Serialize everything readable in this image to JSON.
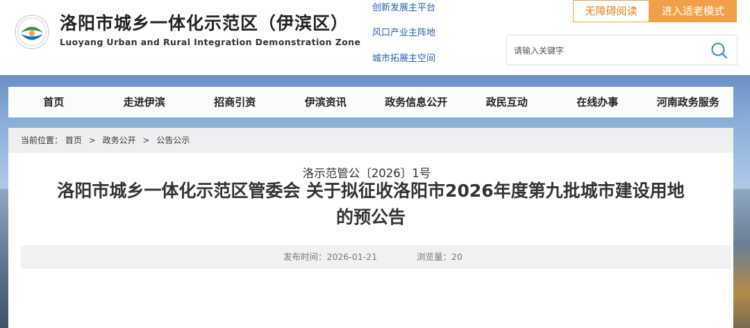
{
  "header": {
    "site_title": "洛阳市城乡一体化示范区（伊滨区）",
    "site_subtitle": "Luoyang Urban and Rural Integration Demonstration Zone",
    "quick_links": [
      "创新发展主平台",
      "风口产业主阵地",
      "城市拓展主空间"
    ],
    "accessibility_label": "无障碍阅读",
    "elder_mode_label": "进入适老模式",
    "search_placeholder": "请输入关键字"
  },
  "nav": {
    "items": [
      "首页",
      "走进伊滨",
      "招商引资",
      "伊滨资讯",
      "政务信息公开",
      "政民互动",
      "在线办事",
      "河南政务服务"
    ]
  },
  "breadcrumb": {
    "prefix": "当前位置：",
    "items": [
      "首页",
      "政务公开",
      "公告公示"
    ],
    "separator": ">"
  },
  "article": {
    "title": "洛阳市城乡一体化示范区管委会 关于拟征收洛阳市2026年度第九批城市建设用地的预公告",
    "publish_time": "发布时间：2026-01-21",
    "views": "浏览量：20",
    "doc_number": "洛示范管公〔2026〕1号"
  },
  "colors": {
    "accent_orange": "#f0a048",
    "link_blue": "#2a5fb0",
    "logo_green": "#2e9b5a",
    "logo_blue": "#1f6fb5"
  }
}
